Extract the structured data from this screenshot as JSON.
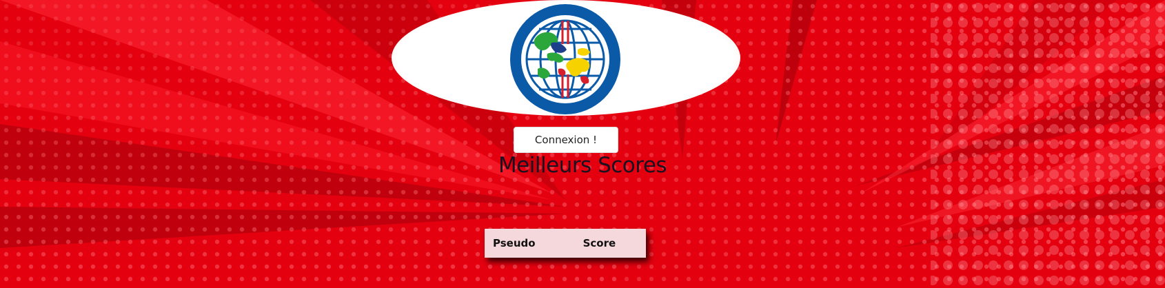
{
  "login": {
    "label": "Connexion !"
  },
  "leaderboard": {
    "title": "Meilleurs Scores",
    "columns": [
      "Pseudo",
      "Score"
    ],
    "rows": []
  },
  "colors": {
    "background": "#e4000f",
    "logo_ring": "#0a5aa8",
    "table_bg": "#f5d8dc"
  },
  "icons": {
    "logo": "globe-logo-icon"
  }
}
